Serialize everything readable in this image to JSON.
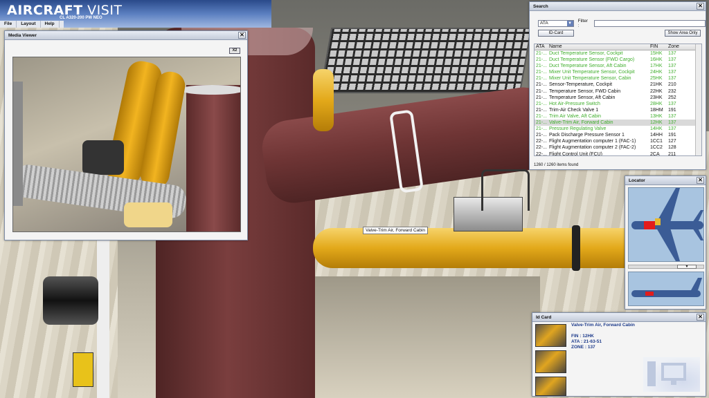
{
  "app": {
    "logo_prefix": "AIRCRAFT",
    "logo_suffix": "VISIT",
    "subtitle": "CL A320-200 PW NEO",
    "menu": [
      "File",
      "Layout",
      "Help"
    ]
  },
  "media_viewer": {
    "title": "Media Viewer",
    "zoom_label": "X2"
  },
  "search": {
    "title": "Search",
    "category": "ATA",
    "filter_label": "Filter :",
    "filter_value": "",
    "id_card_button": "ID-Card",
    "show_area_button": "Show Area Only",
    "columns": [
      "ATA",
      "Name",
      "FIN",
      "Zone"
    ],
    "rows": [
      {
        "ata": "21-...",
        "name": "Duct Temperature Sensor, Cockpit",
        "fin": "15HK",
        "zone": "137",
        "green": true
      },
      {
        "ata": "21-...",
        "name": "Duct Temperature Sensor (FWD Cargo)",
        "fin": "16HK",
        "zone": "137",
        "green": true
      },
      {
        "ata": "21-...",
        "name": "Duct Temperature Sensor, Aft Cabin",
        "fin": "17HK",
        "zone": "137",
        "green": true
      },
      {
        "ata": "21-...",
        "name": "Mixer Unit Temperature Sensor, Cockpit",
        "fin": "24HK",
        "zone": "137",
        "green": true
      },
      {
        "ata": "21-...",
        "name": "Mixer Unit Temperature Sensor, Cabin",
        "fin": "25HK",
        "zone": "137",
        "green": true
      },
      {
        "ata": "21-...",
        "name": "Sensor-Temperature, Cockpit",
        "fin": "21HK",
        "zone": "210",
        "green": false
      },
      {
        "ata": "21-...",
        "name": "Temperature Sensor, FWD Cabin",
        "fin": "22HK",
        "zone": "232",
        "green": false
      },
      {
        "ata": "21-...",
        "name": "Temperature Sensor, Aft Cabin",
        "fin": "23HK",
        "zone": "252",
        "green": false
      },
      {
        "ata": "21-...",
        "name": "Hot Air-Pressure Switch",
        "fin": "28HK",
        "zone": "137",
        "green": true
      },
      {
        "ata": "21-...",
        "name": "Trim-Air Check Valve 1",
        "fin": "18HM",
        "zone": "191",
        "green": false
      },
      {
        "ata": "21-...",
        "name": "Trim Air Valve, Aft Cabin",
        "fin": "13HK",
        "zone": "137",
        "green": true
      },
      {
        "ata": "21-...",
        "name": "Valve-Trim Air, Forward Cabin",
        "fin": "12HK",
        "zone": "137",
        "green": true,
        "selected": true
      },
      {
        "ata": "21-...",
        "name": "Pressure Regulating Valve",
        "fin": "14HK",
        "zone": "137",
        "green": true
      },
      {
        "ata": "21-...",
        "name": "Pack Discharge Pressure Sensor 1",
        "fin": "14HH",
        "zone": "191",
        "green": false
      },
      {
        "ata": "22-...",
        "name": "Flight Augmentation computer 1 (FAC-1)",
        "fin": "1CC1",
        "zone": "127",
        "green": false
      },
      {
        "ata": "22-...",
        "name": "Flight Augmentation computer 2 (FAC-2)",
        "fin": "1CC2",
        "zone": "128",
        "green": false
      },
      {
        "ata": "22-...",
        "name": "Flight Control Unit (FCU)",
        "fin": "2CA",
        "zone": "211",
        "green": false
      }
    ],
    "found_text": "1260 / 1260 items found"
  },
  "locator": {
    "title": "Locator"
  },
  "id_card": {
    "title": "Id Card",
    "name": "Valve-Trim Air, Forward Cabin",
    "fin": "FIN : 12HK",
    "ata": "ATA : 21-63-51",
    "zone": "ZONE : 137"
  },
  "tooltip": "Valve-Trim Air, Forward Cabin",
  "colors": {
    "green_item": "#3fae2c",
    "title_blue": "#1c3a8a",
    "header_blue": "#2a4a8a"
  }
}
